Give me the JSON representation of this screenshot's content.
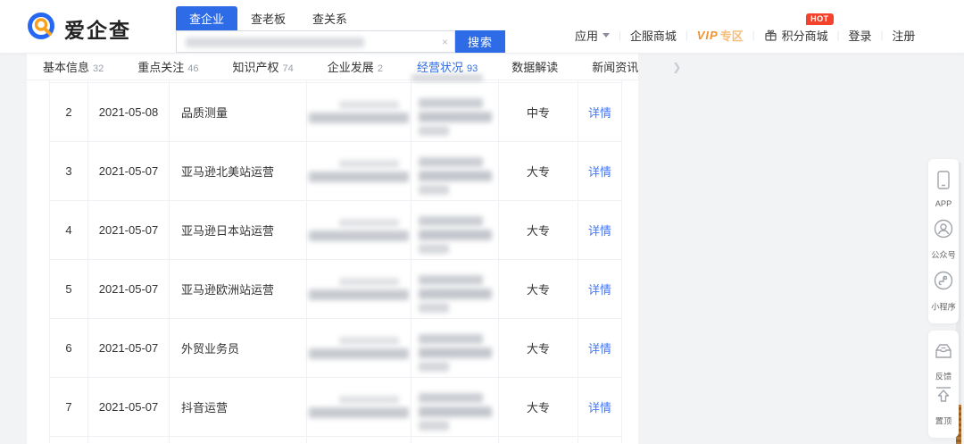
{
  "brand": {
    "name": "爱企查"
  },
  "search": {
    "tabs": [
      {
        "label": "查企业"
      },
      {
        "label": "查老板"
      },
      {
        "label": "查关系"
      }
    ],
    "input_value": "",
    "clear_icon": "×",
    "button_label": "搜索"
  },
  "header_nav": {
    "apps": "应用",
    "mall": "企服商城",
    "vip_prefix": "VIP",
    "vip_suffix": "专区",
    "points_mall": "积分商城",
    "hot_badge": "HOT",
    "login": "登录",
    "register": "注册",
    "separator": "|"
  },
  "section_tabs": [
    {
      "label": "基本信息",
      "count": "32"
    },
    {
      "label": "重点关注",
      "count": "46"
    },
    {
      "label": "知识产权",
      "count": "74"
    },
    {
      "label": "企业发展",
      "count": "2"
    },
    {
      "label": "经营状况",
      "count": "93"
    },
    {
      "label": "数据解读",
      "count": ""
    },
    {
      "label": "新闻资讯",
      "count": ""
    }
  ],
  "table": {
    "rows": [
      {
        "no": "2",
        "date": "2021-05-08",
        "title": "品质测量",
        "edu": "中专",
        "action": "详情"
      },
      {
        "no": "3",
        "date": "2021-05-07",
        "title": "亚马逊北美站运营",
        "edu": "大专",
        "action": "详情"
      },
      {
        "no": "4",
        "date": "2021-05-07",
        "title": "亚马逊日本站运营",
        "edu": "大专",
        "action": "详情"
      },
      {
        "no": "5",
        "date": "2021-05-07",
        "title": "亚马逊欧洲站运营",
        "edu": "大专",
        "action": "详情"
      },
      {
        "no": "6",
        "date": "2021-05-07",
        "title": "外贸业务员",
        "edu": "大专",
        "action": "详情"
      },
      {
        "no": "7",
        "date": "2021-05-07",
        "title": "抖音运营",
        "edu": "大专",
        "action": "详情"
      }
    ]
  },
  "float_sidebar": {
    "group1": [
      {
        "label": "APP"
      },
      {
        "label": "公众号"
      },
      {
        "label": "小程序"
      }
    ],
    "group2": [
      {
        "label": "反馈"
      },
      {
        "label": "置顶"
      }
    ]
  },
  "colors": {
    "accent": "#2e6be6",
    "link": "#4176fa",
    "hot": "#f3432c",
    "vip": "#f0922e"
  }
}
